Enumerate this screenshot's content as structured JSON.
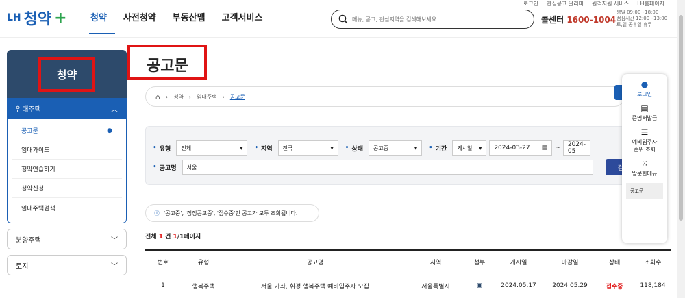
{
  "topbar": {
    "links": [
      "로그인",
      "관심공고 알리미",
      "원격지원 서비스",
      "LH홈페이지"
    ]
  },
  "logo": {
    "lh": "LH",
    "name": "청약",
    "plus": "+"
  },
  "nav": [
    "청약",
    "사전청약",
    "부동산맵",
    "고객서비스"
  ],
  "search": {
    "placeholder": "메뉴, 공고, 관심지역을 검색해보세요"
  },
  "call": {
    "label": "콜센터",
    "number": "1600-1004"
  },
  "hours": {
    "line1": "평일 09:00~18:00",
    "line2": "점심시간 12:00~13:00",
    "line3": "토,일 공휴일 휴무"
  },
  "sidebar": {
    "title": "청약",
    "group1": "임대주택",
    "items": [
      "공고문",
      "임대가이드",
      "청약연습하기",
      "청약신청",
      "임대주택검색"
    ],
    "group2": "분양주택",
    "group3": "토지"
  },
  "page": {
    "title": "공고문"
  },
  "breadcrumb": [
    "청약",
    "임대주택",
    "공고문"
  ],
  "filter": {
    "type_label": "유형",
    "type_value": "전체",
    "region_label": "지역",
    "region_value": "전국",
    "status_label": "상태",
    "status_value": "공고중",
    "period_label": "기간",
    "period_type": "게시일",
    "date_from": "2024-03-27",
    "date_sep": "~",
    "date_to": "2024-05",
    "name_label": "공고명",
    "name_value": "서울",
    "search_btn": "검"
  },
  "notice": "'공고중', '정정공고중', '접수중'인 공고가 모두 조회됩니다.",
  "summary": {
    "pre": "전체",
    "count": "1",
    "mid": "건",
    "page": "1",
    "post": "/1페이지"
  },
  "table": {
    "headers": [
      "번호",
      "유형",
      "공고명",
      "지역",
      "첨부",
      "게시일",
      "마감일",
      "상태",
      "조회수"
    ],
    "rows": [
      {
        "no": "1",
        "type": "행복주택",
        "name": "서울 가좌, 휘경 행복주택 예비입주자 모집",
        "region": "서울특별시",
        "posted": "2024.05.17",
        "deadline": "2024.05.29",
        "status": "접수중",
        "views": "118,184"
      }
    ]
  },
  "quick": {
    "login": "로그인",
    "cert": "증명서발급",
    "waitlist": "예비입주자 순위 조회",
    "visited": "방문한메뉴",
    "last": "공고문"
  }
}
